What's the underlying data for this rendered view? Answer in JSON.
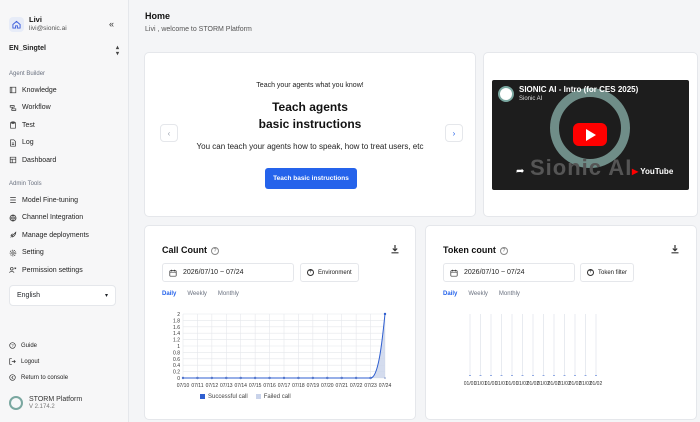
{
  "user": {
    "name": "Livi",
    "email": "livi@sionic.ai"
  },
  "org": "EN_Singtel",
  "agent_builder": {
    "title": "Agent Builder",
    "items": [
      {
        "label": "Knowledge",
        "icon": "book-icon"
      },
      {
        "label": "Workflow",
        "icon": "workflow-icon"
      },
      {
        "label": "Test",
        "icon": "clipboard-icon"
      },
      {
        "label": "Log",
        "icon": "file-icon"
      },
      {
        "label": "Dashboard",
        "icon": "dashboard-icon"
      }
    ]
  },
  "admin_tools": {
    "title": "Admin Tools",
    "items": [
      {
        "label": "Model Fine-tuning",
        "icon": "list-icon"
      },
      {
        "label": "Channel Integration",
        "icon": "globe-icon"
      },
      {
        "label": "Manage deployments",
        "icon": "rocket-icon"
      },
      {
        "label": "Setting",
        "icon": "gear-icon"
      },
      {
        "label": "Permission settings",
        "icon": "users-icon"
      }
    ]
  },
  "language": "English",
  "footer": {
    "guide": "Guide",
    "logout": "Logout",
    "return": "Return to console",
    "brand": "STORM Platform",
    "version": "V 2.174.2"
  },
  "header": {
    "title": "Home",
    "subtitle": "Livi , welcome to STORM Platform"
  },
  "carousel": {
    "small": "Teach your agents what you know!",
    "title_line1": "Teach agents",
    "title_line2": "basic instructions",
    "description": "You can teach your agents how to speak, how to treat users, etc",
    "button": "Teach basic instructions"
  },
  "video": {
    "title": "SIONIC AI - Intro (for CES 2025)",
    "channel": "Sionic AI",
    "overlay_text": "Sionic AI",
    "provider": "YouTube"
  },
  "call_count": {
    "title": "Call Count",
    "date_range": "2026/07/10 ~ 07/24",
    "filter": "Environment",
    "tabs": [
      "Daily",
      "Weekly",
      "Monthly"
    ],
    "legend": [
      "Successful call",
      "Failed call"
    ]
  },
  "token_count": {
    "title": "Token count",
    "date_range": "2026/07/10 ~ 07/24",
    "filter": "Token filter",
    "tabs": [
      "Daily",
      "Weekly",
      "Monthly"
    ]
  },
  "colors": {
    "accent": "#2563eb",
    "success_series": "#2f5fd0",
    "failed_series": "#c9d3ea"
  },
  "chart_data": [
    {
      "type": "area",
      "title": "Call Count",
      "x": [
        "07/10",
        "07/11",
        "07/12",
        "07/13",
        "07/14",
        "07/15",
        "07/16",
        "07/17",
        "07/18",
        "07/19",
        "07/20",
        "07/21",
        "07/22",
        "07/23",
        "07/24"
      ],
      "ylim": [
        0,
        2
      ],
      "yticks": [
        0,
        0.2,
        0.4,
        0.6,
        0.8,
        1,
        1.2,
        1.4,
        1.6,
        1.8,
        2
      ],
      "series": [
        {
          "name": "Successful call",
          "values": [
            0,
            0,
            0,
            0,
            0,
            0,
            0,
            0,
            0,
            0,
            0,
            0,
            0,
            0,
            2
          ]
        },
        {
          "name": "Failed call",
          "values": [
            0,
            0,
            0,
            0,
            0,
            0,
            0,
            0,
            0,
            0,
            0,
            0,
            0,
            0,
            0
          ]
        }
      ],
      "grid": true,
      "legend": "bottom"
    },
    {
      "type": "bar",
      "title": "Token count",
      "categories": [
        "01/01",
        "01/01",
        "01/01",
        "01/01",
        "01/01",
        "01/02",
        "01/02",
        "01/02",
        "01/02",
        "01/02",
        "01/02",
        "01/02",
        "01/02"
      ],
      "values": [
        0,
        0,
        0,
        0,
        0,
        0,
        0,
        0,
        0,
        0,
        0,
        0,
        0
      ]
    }
  ]
}
